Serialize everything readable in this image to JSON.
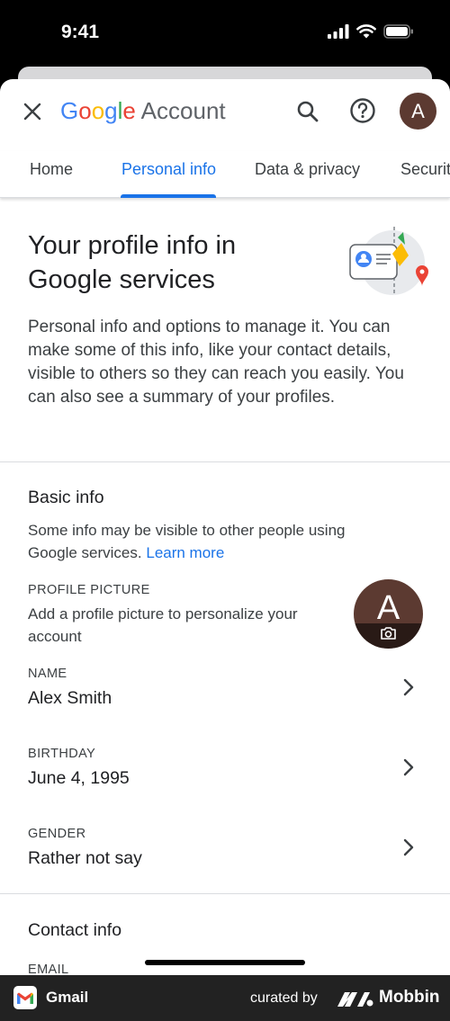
{
  "status_bar": {
    "time": "9:41"
  },
  "app_bar": {
    "logo": {
      "g1": "G",
      "o1": "o",
      "o2": "o",
      "g2": "g",
      "l": "l",
      "e": "e",
      "account": " Account"
    },
    "avatar_letter": "A"
  },
  "tabs": [
    {
      "label": "Home",
      "active": false
    },
    {
      "label": "Personal info",
      "active": true
    },
    {
      "label": "Data & privacy",
      "active": false
    },
    {
      "label": "Security",
      "active": false
    }
  ],
  "intro": {
    "title": "Your profile info in Google services",
    "description": "Personal info and options to manage it. You can make some of this info, like your contact details, visible to others so they can reach you easily. You can also see a summary of your profiles."
  },
  "basic_info": {
    "title": "Basic info",
    "description": "Some info may be visible to other people using Google services.",
    "learn_more": "Learn more",
    "profile_picture": {
      "label": "PROFILE PICTURE",
      "hint": "Add a profile picture to personalize your account",
      "letter": "A"
    },
    "fields": [
      {
        "label": "NAME",
        "value": "Alex Smith"
      },
      {
        "label": "BIRTHDAY",
        "value": "June 4, 1995"
      },
      {
        "label": "GENDER",
        "value": "Rather not say"
      }
    ]
  },
  "contact_info": {
    "title": "Contact info",
    "first_label": "EMAIL"
  },
  "bottom_bar": {
    "app_name": "Gmail",
    "curated_by": "curated by",
    "brand": "Mobbin"
  },
  "colors": {
    "accent": "#1a73e8",
    "avatar": "#5c3a31",
    "google_blue": "#4285F4",
    "google_red": "#EA4335",
    "google_yellow": "#FBBC05",
    "google_green": "#34A853"
  }
}
